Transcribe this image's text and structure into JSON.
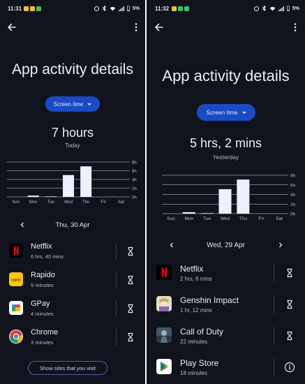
{
  "colors": {
    "background": "#11131c",
    "accent_button": "#1a4bc4",
    "bar_fill": "#eef0ff",
    "divider": "#3a3d4a"
  },
  "left": {
    "status": {
      "time": "11:31",
      "battery": "5%"
    },
    "title": "App activity details",
    "metric_button": "Screen time",
    "total": "7 hours",
    "period": "Today",
    "date_label": "Thu, 30 Apr",
    "apps": [
      {
        "name": "Netflix",
        "time": "6 hrs, 40 mins",
        "icon": "netflix-icon"
      },
      {
        "name": "Rapido",
        "time": "5 minutes",
        "icon": "rapido-icon"
      },
      {
        "name": "GPay",
        "time": "4 minutes",
        "icon": "gpay-icon"
      },
      {
        "name": "Chrome",
        "time": "3 minutes",
        "icon": "chrome-icon"
      }
    ],
    "sites_button": "Show sites that you visit"
  },
  "right": {
    "status": {
      "time": "11:32",
      "battery": "5%"
    },
    "title": "App activity details",
    "metric_button": "Screen time",
    "total": "5 hrs, 2 mins",
    "period": "Yesterday",
    "date_label": "Wed, 29 Apr",
    "apps": [
      {
        "name": "Netflix",
        "time": "2 hrs, 6 mins",
        "icon": "netflix-icon"
      },
      {
        "name": "Genshin Impact",
        "time": "1 hr, 12 mins",
        "icon": "genshin-impact-icon"
      },
      {
        "name": "Call of Duty",
        "time": "22 minutes",
        "icon": "call-of-duty-icon"
      },
      {
        "name": "Play Store",
        "time": "18 minutes",
        "icon": "play-store-icon"
      }
    ]
  },
  "chart_data": [
    {
      "type": "bar",
      "categories": [
        "Sun",
        "Mon",
        "Tue",
        "Wed",
        "Thu",
        "Fri",
        "Sat"
      ],
      "values": [
        0,
        0.3,
        0.1,
        5,
        7,
        0,
        0
      ],
      "ytick_labels": [
        "0h",
        "2h",
        "4h",
        "6h",
        "8h"
      ],
      "ylim": [
        0,
        8
      ],
      "grid": true
    },
    {
      "type": "bar",
      "categories": [
        "Sun",
        "Mon",
        "Tue",
        "Wed",
        "Thu",
        "Fri",
        "Sat"
      ],
      "values": [
        0,
        0.3,
        0.1,
        5.1,
        7.1,
        0,
        0
      ],
      "ytick_labels": [
        "0h",
        "2h",
        "4h",
        "6h",
        "8h"
      ],
      "ylim": [
        0,
        8
      ],
      "grid": true
    }
  ]
}
